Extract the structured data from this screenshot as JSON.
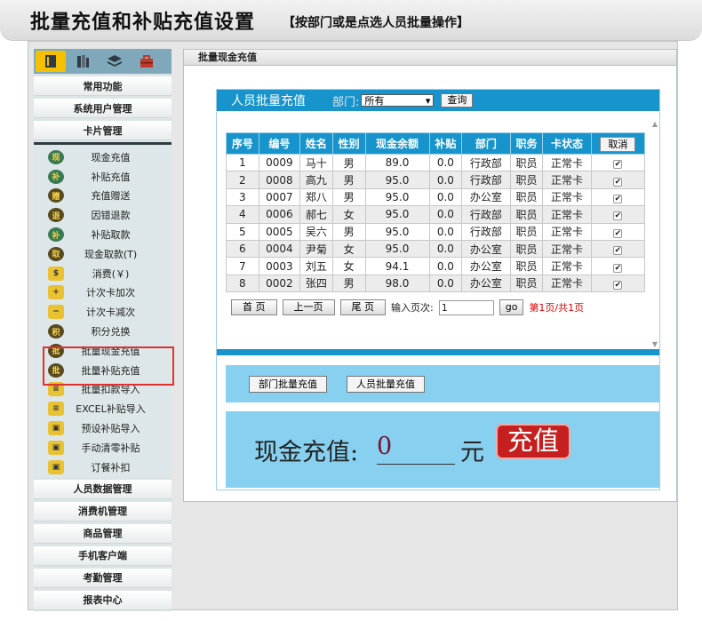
{
  "title": {
    "main": "批量充值和补贴充值设置",
    "sub": "【按部门或是点选人员批量操作】"
  },
  "sidebar": {
    "strip_icons": [
      "book-icon",
      "books-icon",
      "layers-icon",
      "toolbox-icon"
    ],
    "sections_top": [
      {
        "label": "常用功能"
      },
      {
        "label": "系统用户管理"
      },
      {
        "label": "卡片管理"
      }
    ],
    "sub_items": [
      {
        "label": "现金充值",
        "icon_char": "现",
        "icon": "cash-charge-icon",
        "style": "round"
      },
      {
        "label": "补贴充值",
        "icon_char": "补",
        "icon": "subsidy-charge-icon",
        "style": "round"
      },
      {
        "label": "充值赠送",
        "icon_char": "赠",
        "icon": "gift-icon",
        "style": "dark"
      },
      {
        "label": "因错退款",
        "icon_char": "退",
        "icon": "refund-icon",
        "style": "dark"
      },
      {
        "label": "补贴取款",
        "icon_char": "补",
        "icon": "subsidy-withdraw-icon",
        "style": "round"
      },
      {
        "label": "现金取款(T)",
        "icon_char": "取",
        "icon": "cash-withdraw-icon",
        "style": "dark"
      },
      {
        "label": "消费(￥)",
        "icon_char": "$",
        "icon": "consume-icon",
        "style": "gold"
      },
      {
        "label": "计次卡加次",
        "icon_char": "+",
        "icon": "count-add-icon",
        "style": "gold"
      },
      {
        "label": "计次卡减次",
        "icon_char": "−",
        "icon": "count-minus-icon",
        "style": "gold"
      },
      {
        "label": "积分兑换",
        "icon_char": "积",
        "icon": "points-icon",
        "style": "dark"
      },
      {
        "label": "批量现金充值",
        "icon_char": "批",
        "icon": "batch-cash-icon",
        "style": "dark"
      },
      {
        "label": "批量补贴充值",
        "icon_char": "批",
        "icon": "batch-subsidy-icon",
        "style": "dark"
      },
      {
        "label": "批量扣款导入",
        "icon_char": "≡",
        "icon": "batch-deduct-icon",
        "style": "gold"
      },
      {
        "label": "EXCEL补贴导入",
        "icon_char": "≡",
        "icon": "excel-import-icon",
        "style": "gold"
      },
      {
        "label": "预设补贴导入",
        "icon_char": "▣",
        "icon": "preset-subsidy-icon",
        "style": "gold"
      },
      {
        "label": "手动清零补贴",
        "icon_char": "▣",
        "icon": "clear-subsidy-icon",
        "style": "gold"
      },
      {
        "label": "订餐补扣",
        "icon_char": "▣",
        "icon": "meal-order-icon",
        "style": "gold"
      }
    ],
    "sections_bottom": [
      {
        "label": "人员数据管理"
      },
      {
        "label": "消费机管理"
      },
      {
        "label": "商品管理"
      },
      {
        "label": "手机客户端"
      },
      {
        "label": "考勤管理"
      },
      {
        "label": "报表中心"
      }
    ]
  },
  "main": {
    "tab_label": "批量现金充值",
    "filter": {
      "title": "人员批量充值",
      "dept_label": "部门:",
      "dept_value": "所有",
      "query_label": "查询"
    },
    "table": {
      "headers": [
        "序号",
        "编号",
        "姓名",
        "性别",
        "现金余额",
        "补贴",
        "部门",
        "职务",
        "卡状态"
      ],
      "cancel_label": "取消",
      "check_mark": "✔",
      "rows": [
        [
          "1",
          "0009",
          "马十",
          "男",
          "89.0",
          "0.0",
          "行政部",
          "职员",
          "正常卡"
        ],
        [
          "2",
          "0008",
          "高九",
          "男",
          "95.0",
          "0.0",
          "行政部",
          "职员",
          "正常卡"
        ],
        [
          "3",
          "0007",
          "郑八",
          "男",
          "95.0",
          "0.0",
          "办公室",
          "职员",
          "正常卡"
        ],
        [
          "4",
          "0006",
          "郝七",
          "女",
          "95.0",
          "0.0",
          "行政部",
          "职员",
          "正常卡"
        ],
        [
          "5",
          "0005",
          "吴六",
          "男",
          "95.0",
          "0.0",
          "行政部",
          "职员",
          "正常卡"
        ],
        [
          "6",
          "0004",
          "尹菊",
          "女",
          "95.0",
          "0.0",
          "办公室",
          "职员",
          "正常卡"
        ],
        [
          "7",
          "0003",
          "刘五",
          "女",
          "94.1",
          "0.0",
          "办公室",
          "职员",
          "正常卡"
        ],
        [
          "8",
          "0002",
          "张四",
          "男",
          "98.0",
          "0.0",
          "办公室",
          "职员",
          "正常卡"
        ]
      ]
    },
    "pager": {
      "first": "首  页",
      "prev": "上一页",
      "last": "尾  页",
      "goto_label": "输入页次:",
      "page_input": "1",
      "go": "go",
      "info": "第1页/共1页"
    },
    "modes": {
      "dept_batch": "部门批量充值",
      "person_batch": "人员批量充值"
    },
    "amount": {
      "label": "现金充值:",
      "value": "0",
      "unit": "元",
      "charge_button": "充值"
    }
  }
}
